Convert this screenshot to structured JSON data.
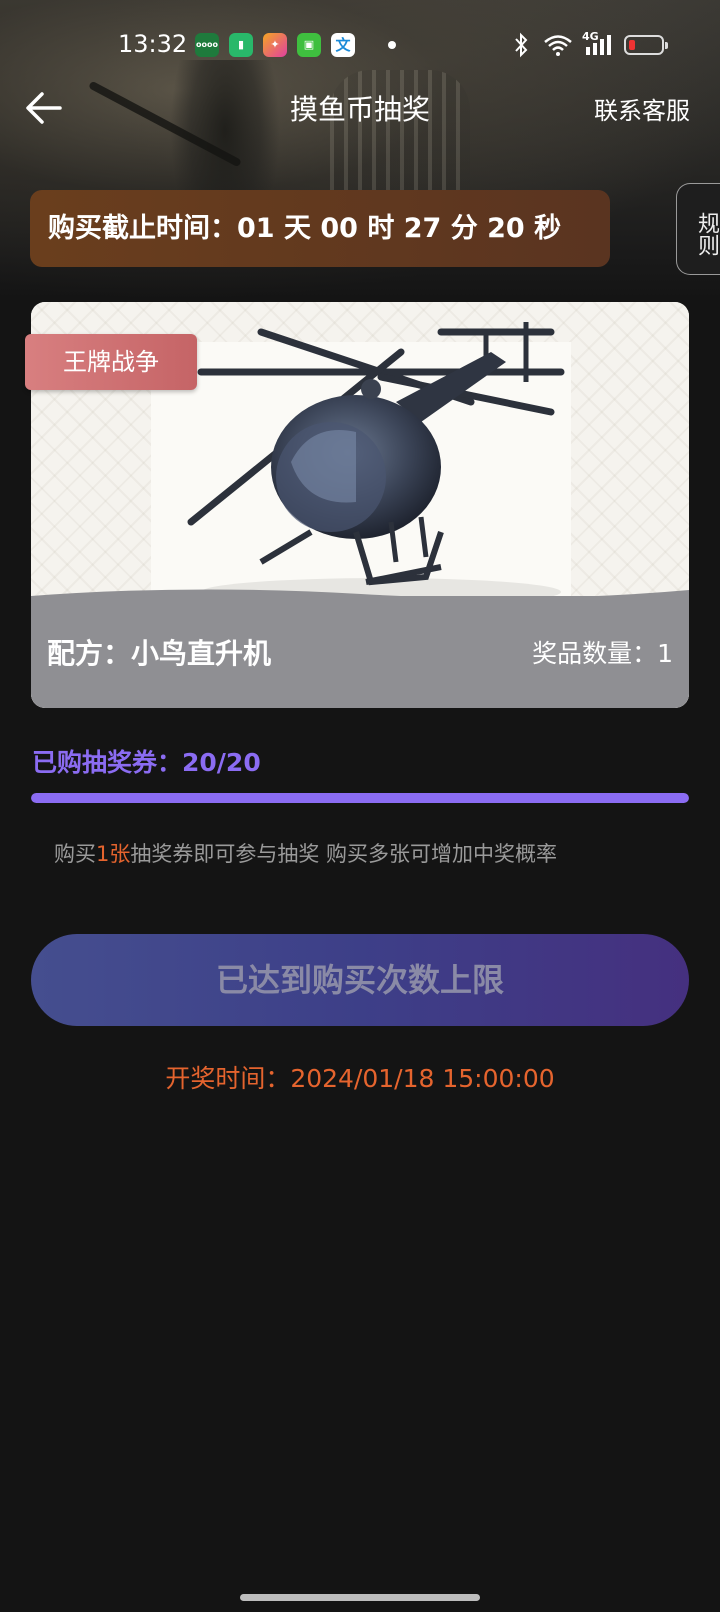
{
  "status_bar": {
    "time": "13:32",
    "app_icons": [
      "oppo-icon",
      "battery-app-icon",
      "camera-app-icon",
      "shopping-app-icon",
      "translate-icon"
    ],
    "translate_glyph": "文",
    "network": "4G"
  },
  "header": {
    "title": "摸鱼币抽奖",
    "contact_label": "联系客服"
  },
  "countdown": {
    "label": "购买截止时间：",
    "value": "01 天 00 时 27 分 20 秒"
  },
  "rules_label": "规则",
  "prize": {
    "tag": "王牌战争",
    "recipe": "配方：小鸟直升机",
    "quantity": "奖品数量：1"
  },
  "purchase": {
    "bought_label": "已购抽奖券：20/20",
    "bought": 20,
    "max": 20,
    "hint_prefix": "购买",
    "hint_highlight": "1张",
    "hint_suffix": "抽奖券即可参与抽奖 购买多张可增加中奖概率",
    "button_label": "已达到购买次数上限"
  },
  "draw_time": "开奖时间：2024/01/18 15:00:00",
  "colors": {
    "accent_purple": "#8b6cf2",
    "accent_orange": "#e5642e",
    "countdown_bg": "#6a3e1d",
    "tag_bg": "#d87f80"
  }
}
